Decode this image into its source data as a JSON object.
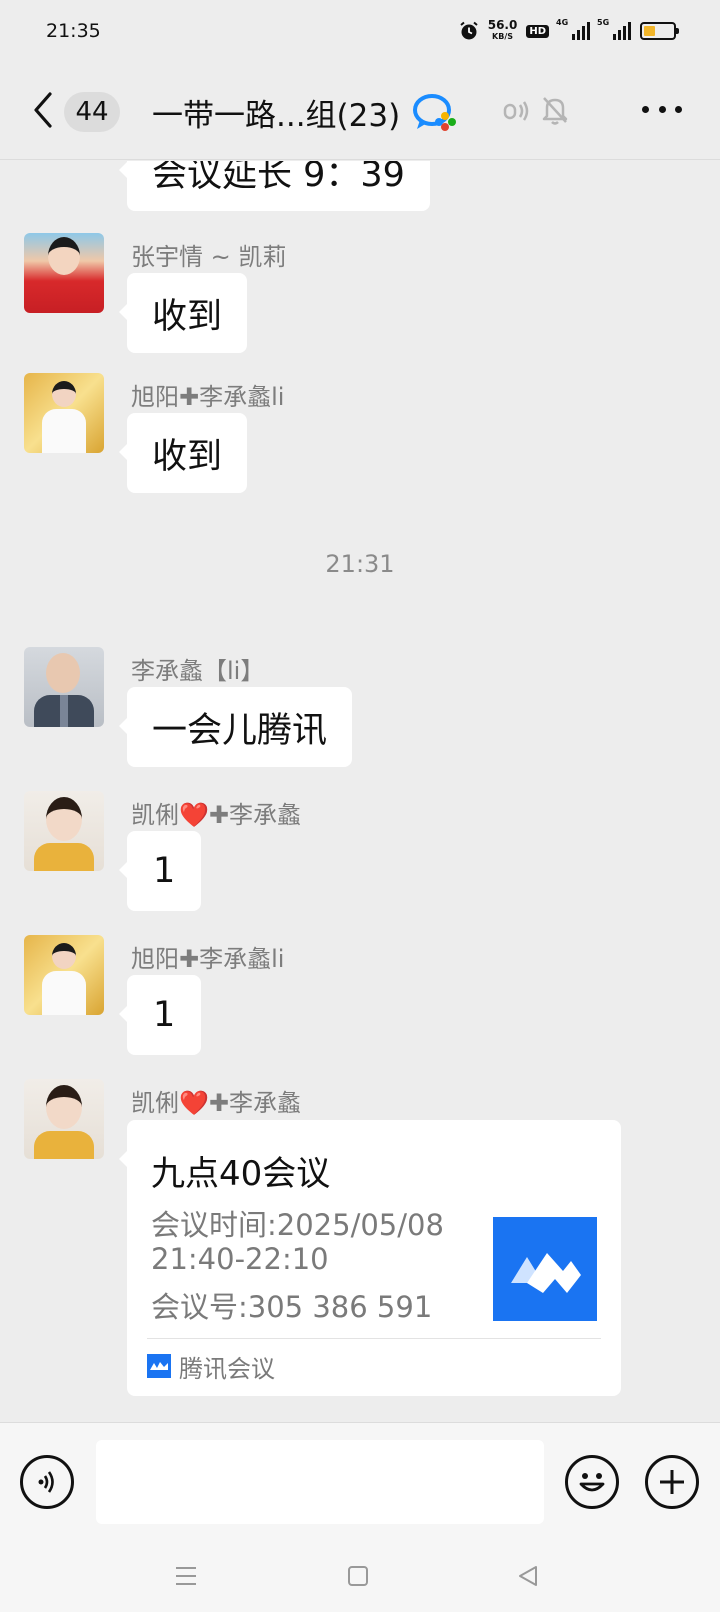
{
  "status_bar": {
    "time": "21:35",
    "net_speed": "56.0",
    "net_unit": "KB/S",
    "hd_label": "HD",
    "signal1_tag": "4G",
    "signal2_tag": "5G",
    "battery_level": 0.4,
    "battery_color": "#f1b52a"
  },
  "header": {
    "unread_count": "44",
    "title": "一带一路...组(23)",
    "icons": [
      "back-arrow-icon",
      "group-chat-icon",
      "voice-output-icon",
      "mute-bell-icon",
      "more-icon"
    ]
  },
  "messages": [
    {
      "sender": "",
      "text": "会议延长 9：39"
    },
    {
      "sender": "张宇情 ~ 凯莉",
      "text": "收到"
    },
    {
      "sender": "旭阳✚李承蠡li",
      "text": "收到"
    },
    {
      "sender": "李承蠡【li】",
      "text": "一会儿腾讯"
    },
    {
      "sender": "凯俐❤️✚李承蠡",
      "text": "1"
    },
    {
      "sender": "旭阳✚李承蠡li",
      "text": "1"
    },
    {
      "sender": "凯俐❤️✚李承蠡",
      "text": ""
    }
  ],
  "time_separator": "21:31",
  "meeting_card": {
    "title": "九点40会议",
    "time_line1": "会议时间:2025/05/08",
    "time_line2": "21:40-22:10",
    "meeting_id": "会议号:305 386 591",
    "source": "腾讯会议",
    "brand_color": "#1a74f2"
  },
  "input_bar": {
    "placeholder": "",
    "icons": [
      "voice-input-icon",
      "emoji-icon",
      "plus-icon"
    ]
  },
  "nav_bar": {
    "icons": [
      "menu-icon",
      "home-icon",
      "back-triangle-icon"
    ]
  }
}
